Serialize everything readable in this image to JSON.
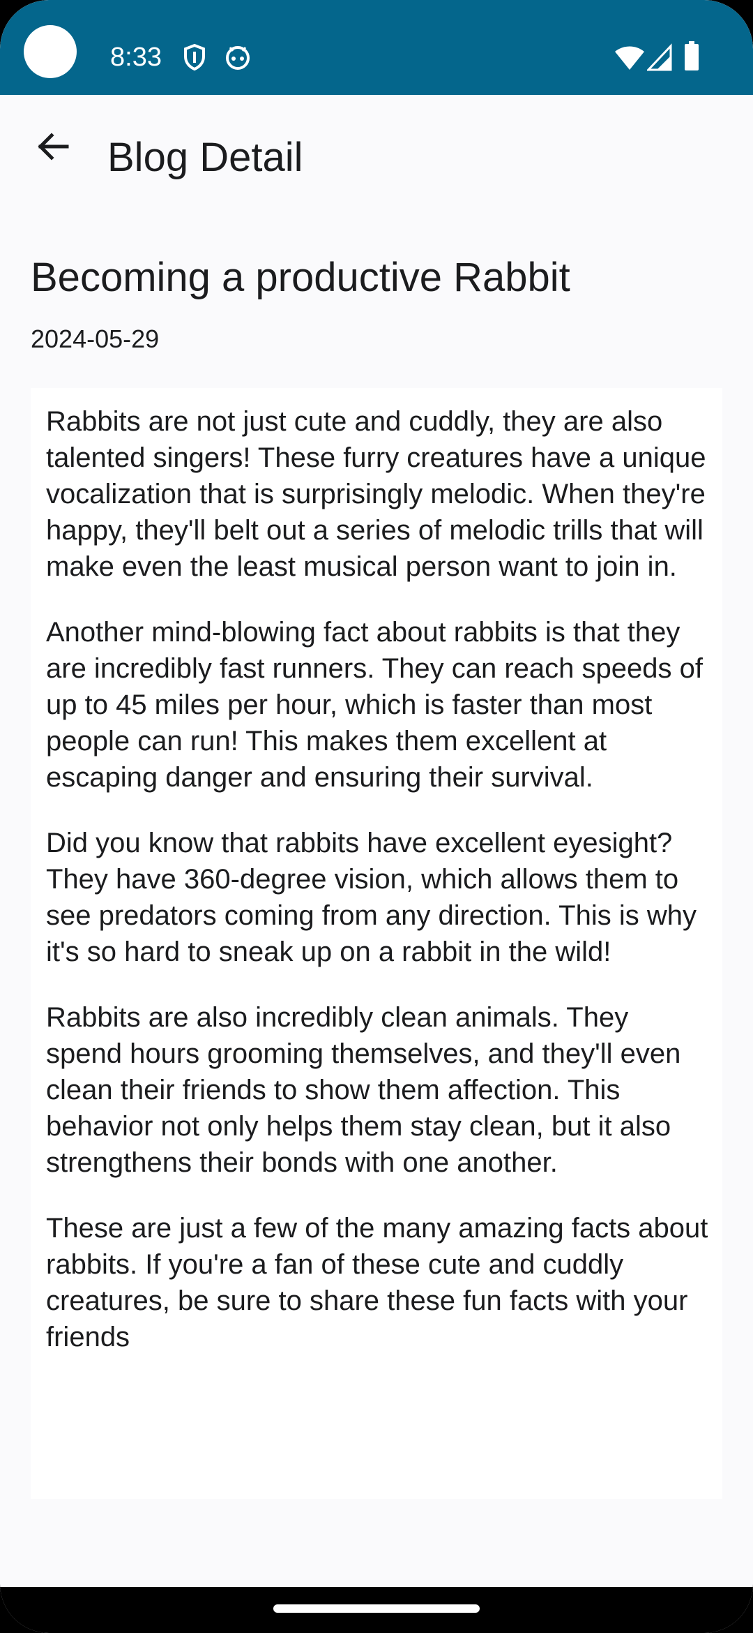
{
  "status_bar": {
    "time": "8:33",
    "bg_color": "#04668c",
    "left_icons": [
      "shield-icon",
      "android-face-icon"
    ],
    "right_icons": [
      "wifi-icon",
      "cell-signal-icon",
      "battery-icon"
    ]
  },
  "app_bar": {
    "back_icon": "arrow-back-icon",
    "title": "Blog Detail"
  },
  "post": {
    "title": "Becoming a productive Rabbit",
    "date": "2024-05-29",
    "paragraphs": [
      "Rabbits are not just cute and cuddly, they are also talented singers! These furry creatures have a unique vocalization that is surprisingly melodic. When they're happy, they'll belt out a series of melodic trills that will make even the least musical person want to join in.",
      "Another mind-blowing fact about rabbits is that they are incredibly fast runners. They can reach speeds of up to 45 miles per hour, which is faster than most people can run! This makes them excellent at escaping danger and ensuring their survival.",
      "Did you know that rabbits have excellent eyesight? They have 360-degree vision, which allows them to see predators coming from any direction. This is why it's so hard to sneak up on a rabbit in the wild!",
      "Rabbits are also incredibly clean animals. They spend hours grooming themselves, and they'll even clean their friends to show them affection. This behavior not only helps them stay clean, but it also strengthens their bonds with one another.",
      "These are just a few of the many amazing facts about rabbits. If you're a fan of these cute and cuddly creatures, be sure to share these fun facts with your friends"
    ]
  }
}
